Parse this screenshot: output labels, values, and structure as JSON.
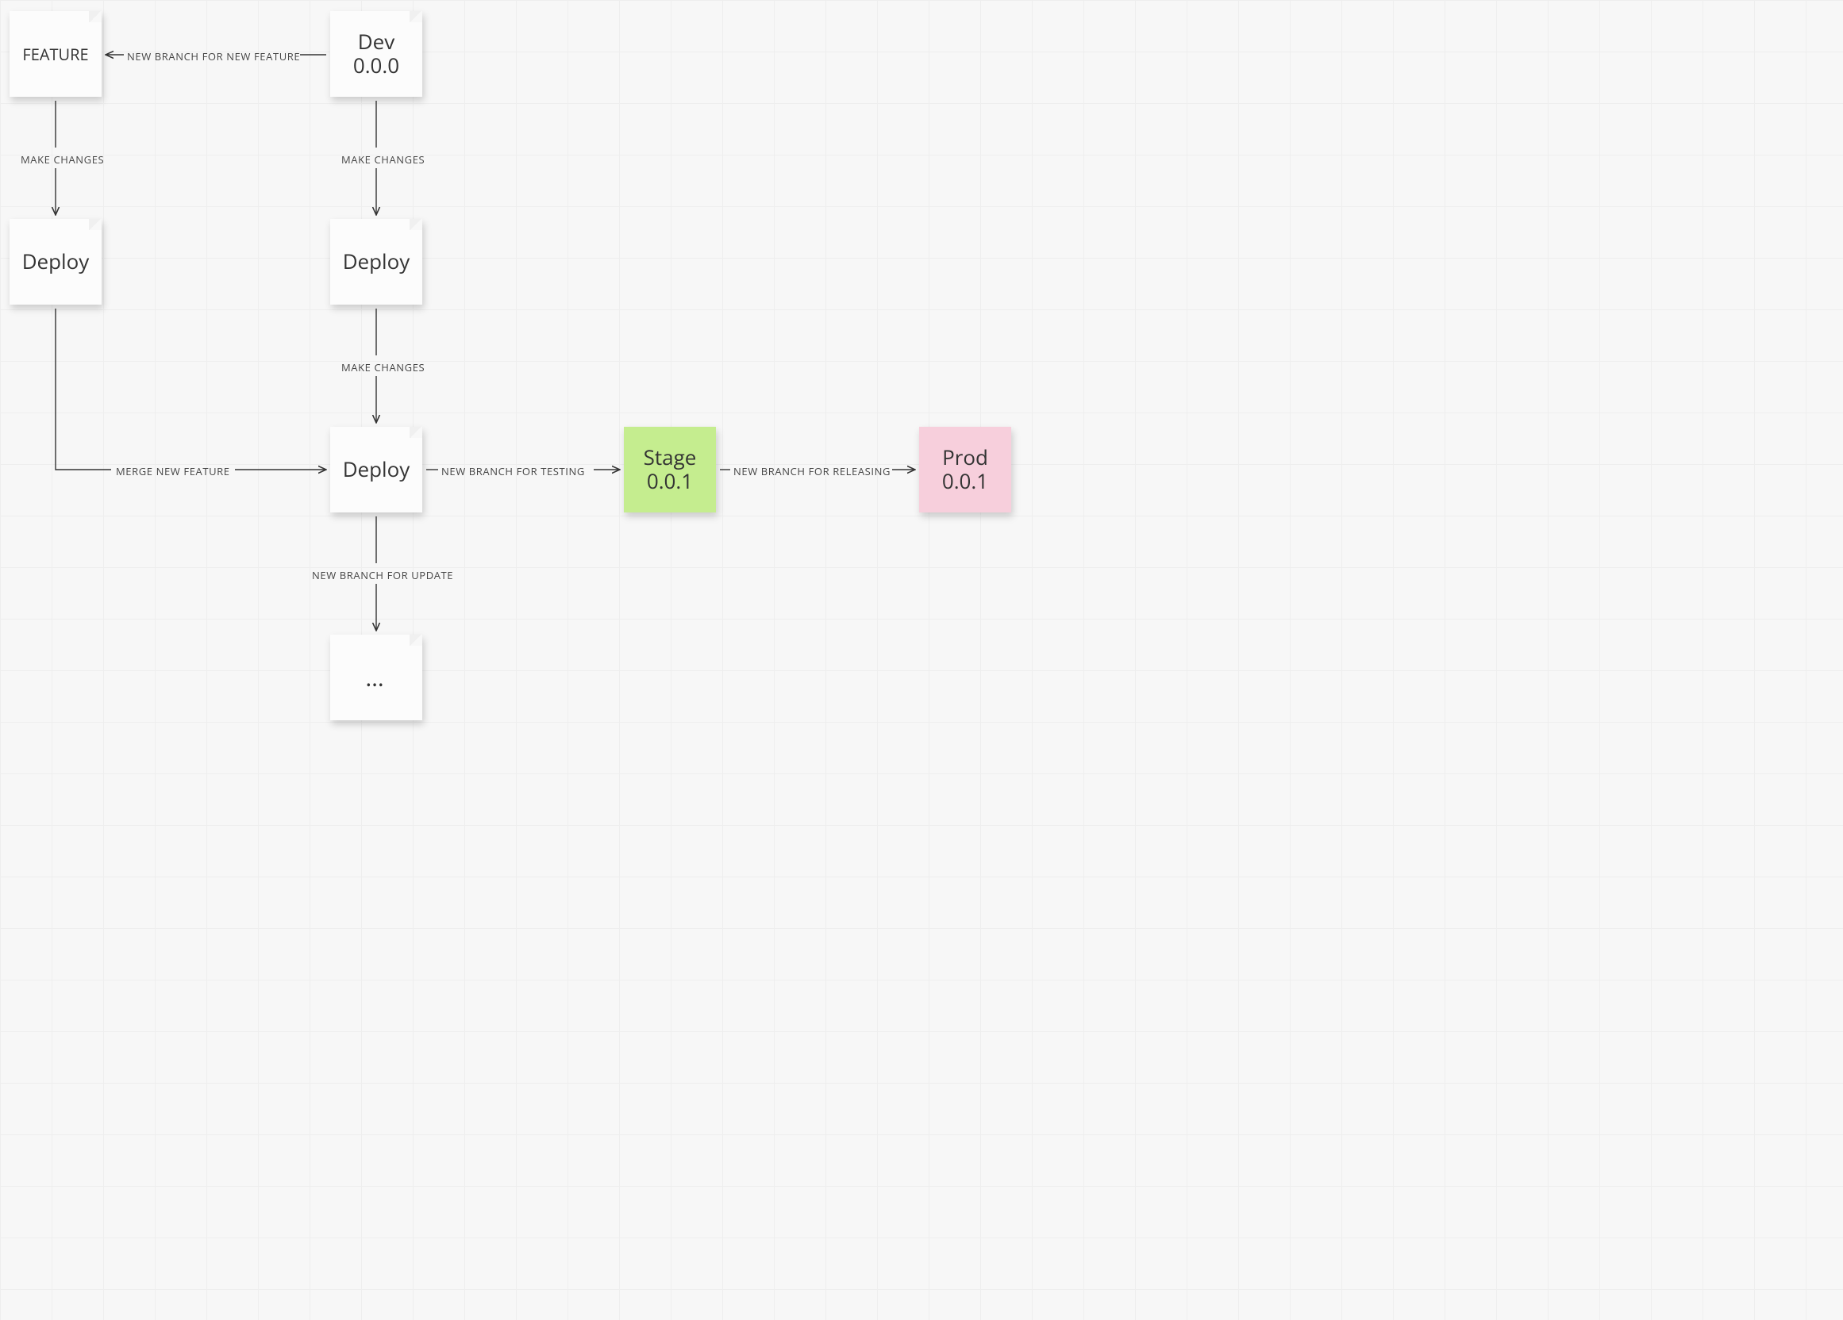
{
  "nodes": {
    "feature": "FEATURE",
    "dev_name": "Dev",
    "dev_ver": "0.0.0",
    "deploy_left": "Deploy",
    "deploy_mid1": "Deploy",
    "deploy_mid2": "Deploy",
    "ellipsis": "…",
    "stage_name": "Stage",
    "stage_ver": "0.0.1",
    "prod_name": "Prod",
    "prod_ver": "0.0.1"
  },
  "edges": {
    "new_branch_feature": "NEW BRANCH FOR NEW FEATURE",
    "make_changes_left": "MAKE CHANGES",
    "make_changes_mid1": "MAKE CHANGES",
    "make_changes_mid2": "MAKE CHANGES",
    "merge_feature": "MERGE NEW FEATURE",
    "new_branch_update": "NEW BRANCH FOR UPDATE",
    "new_branch_testing": "NEW BRANCH FOR TESTING",
    "new_branch_releasing": "NEW BRANCH FOR RELEASING"
  }
}
